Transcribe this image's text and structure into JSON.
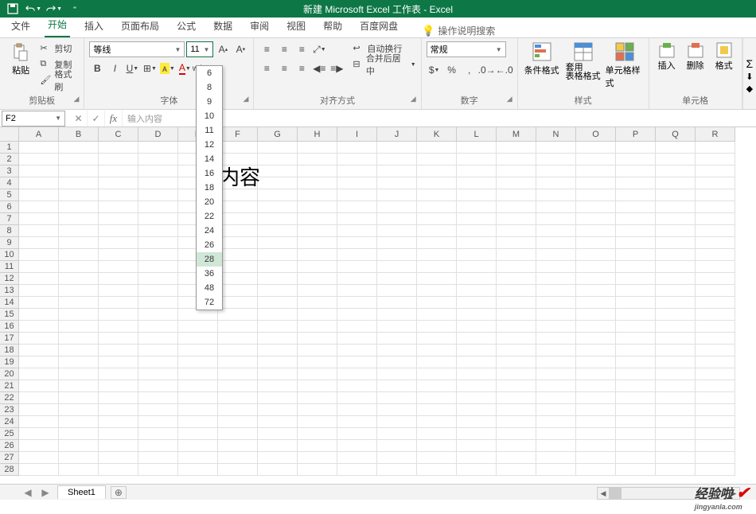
{
  "title": "新建 Microsoft Excel 工作表 - Excel",
  "menus": {
    "file": "文件",
    "home": "开始",
    "insert": "插入",
    "layout": "页面布局",
    "formula": "公式",
    "data": "数据",
    "review": "审阅",
    "view": "视图",
    "help": "帮助",
    "baidu": "百度网盘",
    "tellme": "操作说明搜索"
  },
  "ribbon": {
    "clipboard": {
      "label": "剪贴板",
      "paste": "粘贴",
      "cut": "剪切",
      "copy": "复制",
      "painter": "格式刷"
    },
    "font": {
      "label": "字体",
      "name": "等线",
      "size": "11"
    },
    "alignment": {
      "label": "对齐方式",
      "wrap": "自动换行",
      "merge": "合并后居中"
    },
    "number": {
      "label": "数字",
      "format": "常规"
    },
    "styles": {
      "label": "样式",
      "cond": "条件格式",
      "table": "套用\n表格格式",
      "cell": "单元格样式"
    },
    "cells": {
      "label": "单元格",
      "insert": "插入",
      "delete": "删除",
      "format": "格式"
    }
  },
  "font_sizes": [
    "6",
    "8",
    "9",
    "10",
    "11",
    "12",
    "14",
    "16",
    "18",
    "20",
    "22",
    "24",
    "26",
    "28",
    "36",
    "48",
    "72"
  ],
  "font_size_hover": "28",
  "namebox": "F2",
  "formula": "输入内容",
  "cell_display": "入内容",
  "columns": [
    "A",
    "B",
    "C",
    "D",
    "E",
    "F",
    "G",
    "H",
    "I",
    "J",
    "K",
    "L",
    "M",
    "N",
    "O",
    "P",
    "Q",
    "R"
  ],
  "row_count": 28,
  "sheet_tab": "Sheet1",
  "watermark": "经验啦",
  "watermark_url": "jingyanla.com"
}
